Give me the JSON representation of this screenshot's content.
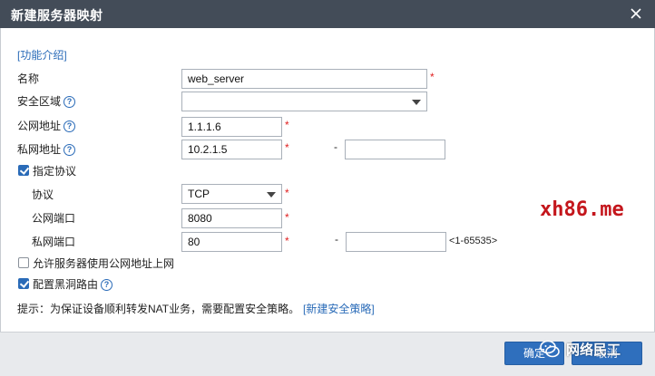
{
  "dialog": {
    "title": "新建服务器映射",
    "intro_link": "[功能介绍]"
  },
  "form": {
    "name_label": "名称",
    "name_value": "web_server",
    "zone_label": "安全区域",
    "zone_value": "",
    "public_ip_label": "公网地址",
    "public_ip_value": "1.1.1.6",
    "private_ip_label": "私网地址",
    "private_ip_value": "10.2.1.5",
    "private_ip_end_value": "",
    "range_sep": "-",
    "specify_protocol_label": "指定协议",
    "specify_protocol_checked": true,
    "protocol_label": "协议",
    "protocol_value": "TCP",
    "public_port_label": "公网端口",
    "public_port_value": "8080",
    "private_port_label": "私网端口",
    "private_port_value": "80",
    "private_port_end_value": "",
    "port_range_hint": "<1-65535>",
    "allow_server_label": "允许服务器使用公网地址上网",
    "allow_server_checked": false,
    "blackhole_label": "配置黑洞路由",
    "blackhole_checked": true,
    "required_mark": "*",
    "hint_text": "提示：为保证设备顺利转发NAT业务，需要配置安全策略。",
    "new_policy_link": "[新建安全策略]"
  },
  "footer": {
    "ok_label": "确定",
    "cancel_label": "取消"
  },
  "watermarks": {
    "site": "xh86.me",
    "badge": "网络民工"
  },
  "colors": {
    "titlebar": "#434c58",
    "link": "#2a6bb8",
    "required": "#e02020",
    "button": "#2f6fbd",
    "watermark": "#c4161c"
  },
  "icons": {
    "close": "close-icon",
    "help": "help-icon",
    "dropdown": "chevron-down-icon",
    "check": "check-icon"
  }
}
